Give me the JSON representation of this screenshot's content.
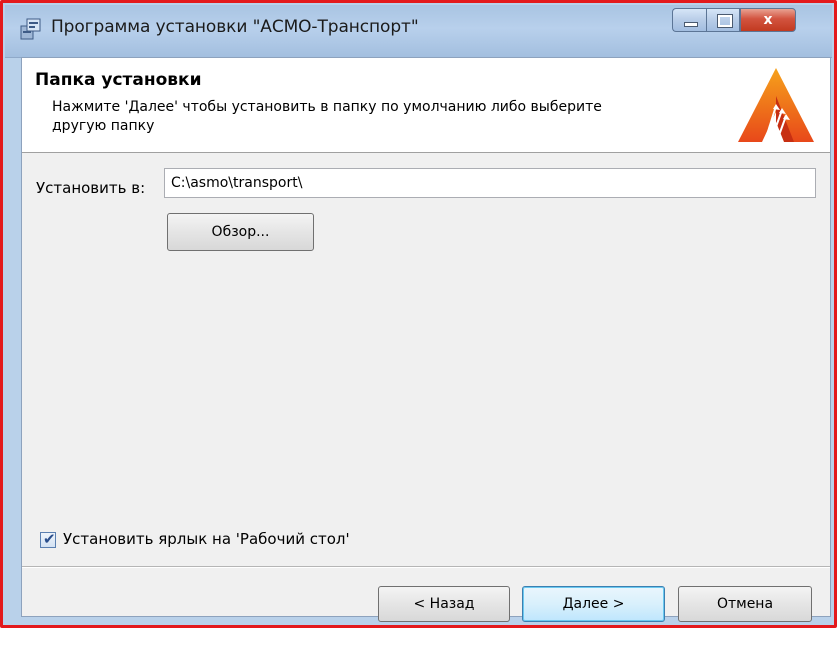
{
  "window": {
    "title": "Программа установки \"АСМО-Транспорт\"",
    "controls": {
      "minimize": "minimize-icon",
      "maximize": "maximize-icon",
      "close": "close-icon",
      "close_glyph": "x"
    }
  },
  "header": {
    "title": "Папка установки",
    "description": "Нажмите 'Далее' чтобы установить в папку по умолчанию либо выберите другую папку",
    "logo": "asmo-logo"
  },
  "install": {
    "label": "Установить в:",
    "path": "C:\\asmo\\transport\\",
    "browse_label": "Обзор..."
  },
  "shortcut": {
    "checked": true,
    "label": "Установить ярлык на 'Рабочий стол'"
  },
  "footer": {
    "back_label": "< Назад",
    "next_label": "Далее >",
    "cancel_label": "Отмена"
  },
  "colors": {
    "frame_border": "#e3191c",
    "titlebar": "#b8d0ec",
    "dialog_bg": "#f0f0f0",
    "logo_primary": "#e8481a",
    "logo_secondary": "#f6a21b"
  }
}
